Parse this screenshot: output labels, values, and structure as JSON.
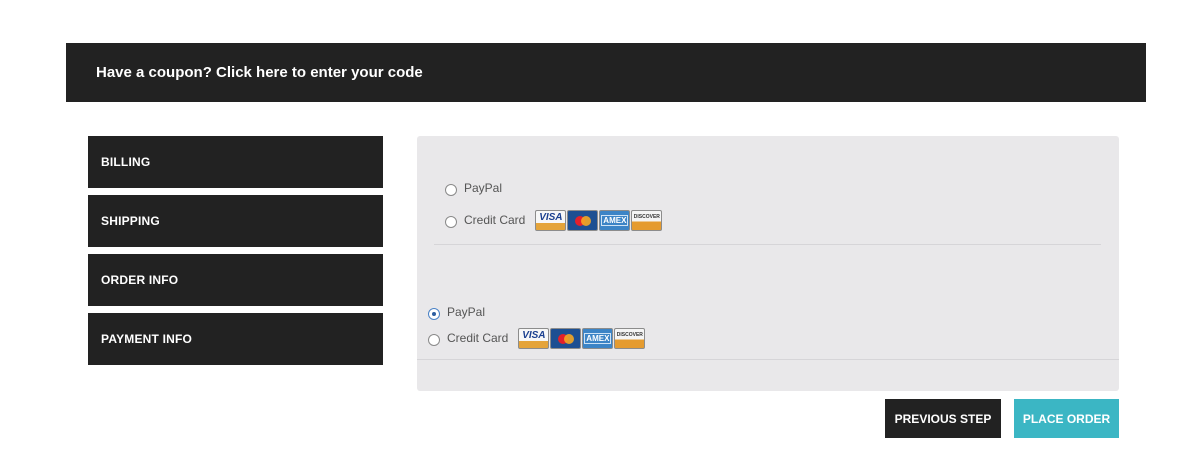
{
  "coupon": {
    "text": "Have a coupon? Click here to enter your code"
  },
  "steps": [
    {
      "label": "BILLING"
    },
    {
      "label": "SHIPPING"
    },
    {
      "label": "ORDER INFO"
    },
    {
      "label": "PAYMENT INFO"
    }
  ],
  "payment_group_1": {
    "options": [
      {
        "label": "PayPal",
        "selected": false
      },
      {
        "label": "Credit Card",
        "selected": false
      }
    ]
  },
  "payment_group_2": {
    "options": [
      {
        "label": "PayPal",
        "selected": true
      },
      {
        "label": "Credit Card",
        "selected": false
      }
    ]
  },
  "card_logos": {
    "visa": "VISA",
    "mastercard": "mastercard",
    "amex": "AMEX",
    "discover": "DISCOVER"
  },
  "buttons": {
    "previous": "PREVIOUS STEP",
    "place_order": "PLACE ORDER"
  },
  "colors": {
    "dark": "#222222",
    "accent": "#3bb6c4",
    "panel": "#e9e8ea"
  }
}
